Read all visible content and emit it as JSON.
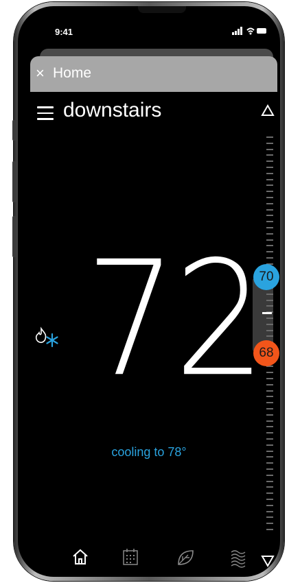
{
  "status_bar": {
    "time": "9:41",
    "icons": "all \u0007 ▬"
  },
  "header": {
    "close_label": "×",
    "title": "Home"
  },
  "zone": {
    "name": "downstairs"
  },
  "thermostat": {
    "current_temp": "72",
    "cool_setpoint": "70",
    "heat_setpoint": "68",
    "status": "cooling to 78°",
    "mode_icon": "flame-snowflake-icon"
  },
  "nav": {
    "items": [
      "home-icon",
      "schedule-icon",
      "leaf-icon",
      "fan-icon"
    ]
  },
  "colors": {
    "cool": "#2aa3df",
    "heat": "#f2551a"
  }
}
